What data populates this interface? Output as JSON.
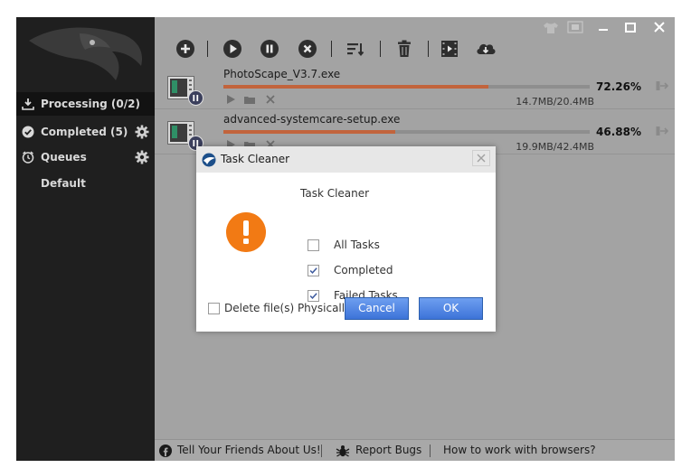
{
  "sidebar": {
    "processing": "Processing (0/2)",
    "completed": "Completed (5)",
    "queues": "Queues",
    "default": "Default"
  },
  "downloads": [
    {
      "name": "PhotoScape_V3.7.exe",
      "size": "14.7MB/20.4MB",
      "percent": "72.26%",
      "progress": 0.7226
    },
    {
      "name": "advanced-systemcare-setup.exe",
      "size": "19.9MB/42.4MB",
      "percent": "46.88%",
      "progress": 0.4688
    }
  ],
  "footer": {
    "tell_friends": "Tell Your Friends About Us!",
    "report_bugs": "Report Bugs",
    "browsers": "How to work with browsers?"
  },
  "dialog": {
    "title": "Task Cleaner",
    "heading": "Task Cleaner",
    "options": [
      {
        "label": "All Tasks",
        "checked": false
      },
      {
        "label": "Completed",
        "checked": true
      },
      {
        "label": "Failed Tasks",
        "checked": true
      }
    ],
    "delete_label": "Delete file(s) Physically",
    "delete_checked": false,
    "cancel": "Cancel",
    "ok": "OK"
  },
  "colors": {
    "progress_fill": "#c2643c",
    "sidebar_bg": "#1f1f1f",
    "warning": "#f27a14",
    "button_blue": "#3d73d8"
  }
}
